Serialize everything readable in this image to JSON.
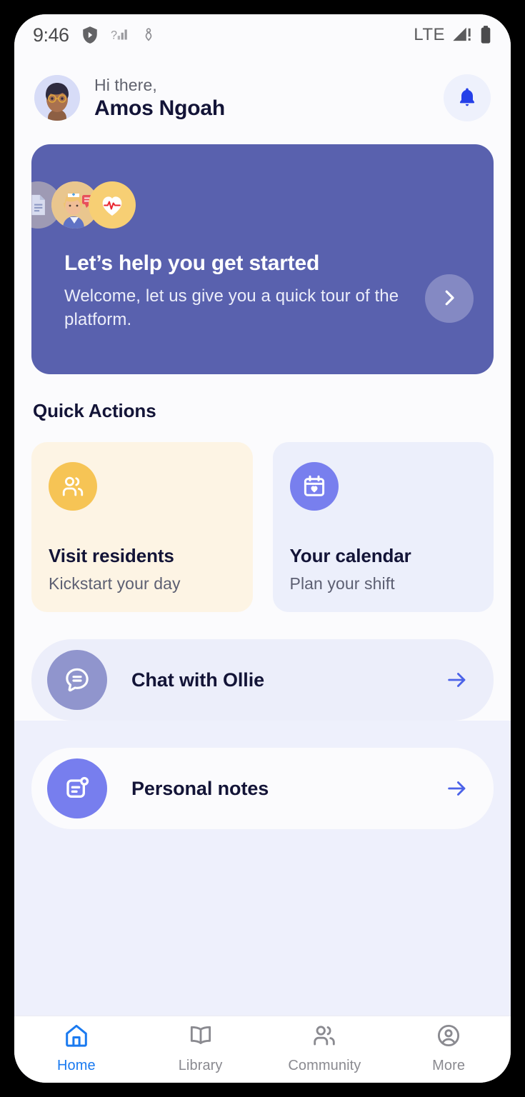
{
  "status_bar": {
    "time": "9:46",
    "network_label": "LTE",
    "icons": [
      "shield-icon",
      "signal-unknown-icon",
      "health-heart-icon",
      "signal-bars-warning-icon",
      "battery-full-icon"
    ]
  },
  "header": {
    "greeting": "Hi there,",
    "user_name": "Amos Ngoah",
    "avatar_name": "user-avatar",
    "notification_icon": "bell-icon"
  },
  "hero": {
    "title": "Let’s help you get started",
    "subtitle": "Welcome, let us give you a quick tour of the platform.",
    "next_icon": "chevron-right-icon",
    "background_color": "#5961ae",
    "avatars": [
      "document-avatar",
      "nurse-avatar",
      "heartbeat-avatar"
    ]
  },
  "quick_actions": {
    "section_title": "Quick Actions",
    "cards": [
      {
        "title": "Visit residents",
        "subtitle": "Kickstart your day",
        "icon": "users-icon",
        "icon_color": "#f6c455",
        "card_color": "#fdf4e4"
      },
      {
        "title": "Your calendar",
        "subtitle": "Plan your shift",
        "icon": "calendar-heart-icon",
        "icon_color": "#787fee",
        "card_color": "#ecefFb"
      }
    ]
  },
  "rows": [
    {
      "label": "Chat with Ollie",
      "icon": "chat-bubble-icon",
      "icon_color": "#9095cd",
      "arrow_icon": "arrow-right-icon"
    },
    {
      "label": "Personal notes",
      "icon": "notes-icon",
      "icon_color": "#777eee",
      "arrow_icon": "arrow-right-icon"
    }
  ],
  "bottom_nav": {
    "active": "Home",
    "active_color": "#1a7af0",
    "items": [
      {
        "label": "Home",
        "icon": "home-icon"
      },
      {
        "label": "Library",
        "icon": "book-icon"
      },
      {
        "label": "Community",
        "icon": "people-icon"
      },
      {
        "label": "More",
        "icon": "account-circle-icon"
      }
    ]
  }
}
